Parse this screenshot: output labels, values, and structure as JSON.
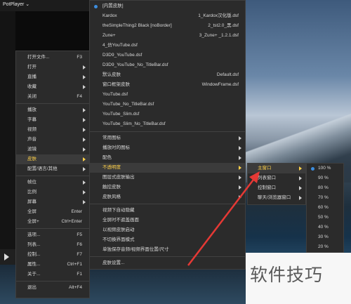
{
  "app": {
    "title": "PotPlayer ⌄"
  },
  "main_menu": {
    "items": [
      {
        "label": "打开文件...",
        "shortcut": "F3"
      },
      {
        "label": "打开",
        "submenu": true
      },
      {
        "label": "直播",
        "submenu": true
      },
      {
        "label": "收藏",
        "submenu": true
      },
      {
        "label": "关闭",
        "shortcut": "F4"
      },
      {
        "label": "播放",
        "submenu": true
      },
      {
        "label": "字幕",
        "submenu": true
      },
      {
        "label": "视频",
        "submenu": true
      },
      {
        "label": "声音",
        "submenu": true
      },
      {
        "label": "滤镜",
        "submenu": true
      },
      {
        "label": "皮肤",
        "submenu": true
      },
      {
        "label": "配置/语言/其他",
        "submenu": true
      },
      {
        "label": "帧位",
        "submenu": true
      },
      {
        "label": "比例",
        "submenu": true
      },
      {
        "label": "屏幕",
        "submenu": true
      },
      {
        "label": "全屏",
        "shortcut": "Enter"
      },
      {
        "label": "全屏+",
        "shortcut": "Ctrl+Enter"
      },
      {
        "label": "选项...",
        "shortcut": "F5"
      },
      {
        "label": "列表...",
        "shortcut": "F6"
      },
      {
        "label": "控制...",
        "shortcut": "F7"
      },
      {
        "label": "属性...",
        "shortcut": "Ctrl+F1"
      },
      {
        "label": "关于...",
        "shortcut": "F1"
      },
      {
        "label": "退出",
        "shortcut": "Alt+F4"
      }
    ]
  },
  "skin_menu": {
    "items": [
      {
        "label": "[内置皮肤]",
        "shortcut": ""
      },
      {
        "label": "Kardox",
        "shortcut": "1_Kardox汉化版.dsf"
      },
      {
        "label": "theSimpleThing2 Black [noBorder]",
        "shortcut": "2_tst2.0_黑.dsf"
      },
      {
        "label": "Zune+",
        "shortcut": "3_Zune+ _1.2.1.dsf"
      },
      {
        "label": "4_仿YouTube.dsf",
        "shortcut": ""
      },
      {
        "label": "D3D9_YouTube.dsf",
        "shortcut": ""
      },
      {
        "label": "D3D9_YouTube_No_TitleBar.dsf",
        "shortcut": ""
      },
      {
        "label": "默认皮肤",
        "shortcut": "Default.dsf"
      },
      {
        "label": "窗口框架皮肤",
        "shortcut": "WindowFrame.dsf"
      },
      {
        "label": "YouTube.dsf",
        "shortcut": ""
      },
      {
        "label": "YouTube_No_TitleBar.dsf",
        "shortcut": ""
      },
      {
        "label": "YouTube_Slim.dsf",
        "shortcut": ""
      },
      {
        "label": "YouTube_Slim_No_TitleBar.dsf",
        "shortcut": ""
      },
      {
        "label": "常用图标",
        "submenu": true
      },
      {
        "label": "播放时的图标",
        "submenu": true
      },
      {
        "label": "配色",
        "submenu": true
      },
      {
        "label": "不透明度",
        "submenu": true
      },
      {
        "label": "图层式皮肤输出",
        "submenu": true
      },
      {
        "label": "触控皮肤",
        "submenu": true
      },
      {
        "label": "皮肤风格",
        "submenu": true
      },
      {
        "label": "视频下自动隐藏"
      },
      {
        "label": "全屏时不遮盖画面"
      },
      {
        "label": "以视频皮肤启动"
      },
      {
        "label": "不切换界面模式"
      },
      {
        "label": "单独保存音频/视频界面位置/尺寸"
      },
      {
        "label": "皮肤设置..."
      }
    ]
  },
  "opacity_menu": {
    "items": [
      {
        "label": "主窗口"
      },
      {
        "label": "列表窗口"
      },
      {
        "label": "控制窗口"
      },
      {
        "label": "聊天/浏览器窗口"
      }
    ]
  },
  "percent_menu": {
    "items": [
      "100 %",
      "90 %",
      "80 %",
      "70 %",
      "60 %",
      "50 %",
      "40 %",
      "30 %",
      "20 %"
    ]
  },
  "watermark": "软件技巧",
  "colors": {
    "menu_bg": "#2b2b2b",
    "highlight_text": "#ffd14a",
    "selected_dot": "#3c8dde",
    "arrow": "#e53935"
  }
}
